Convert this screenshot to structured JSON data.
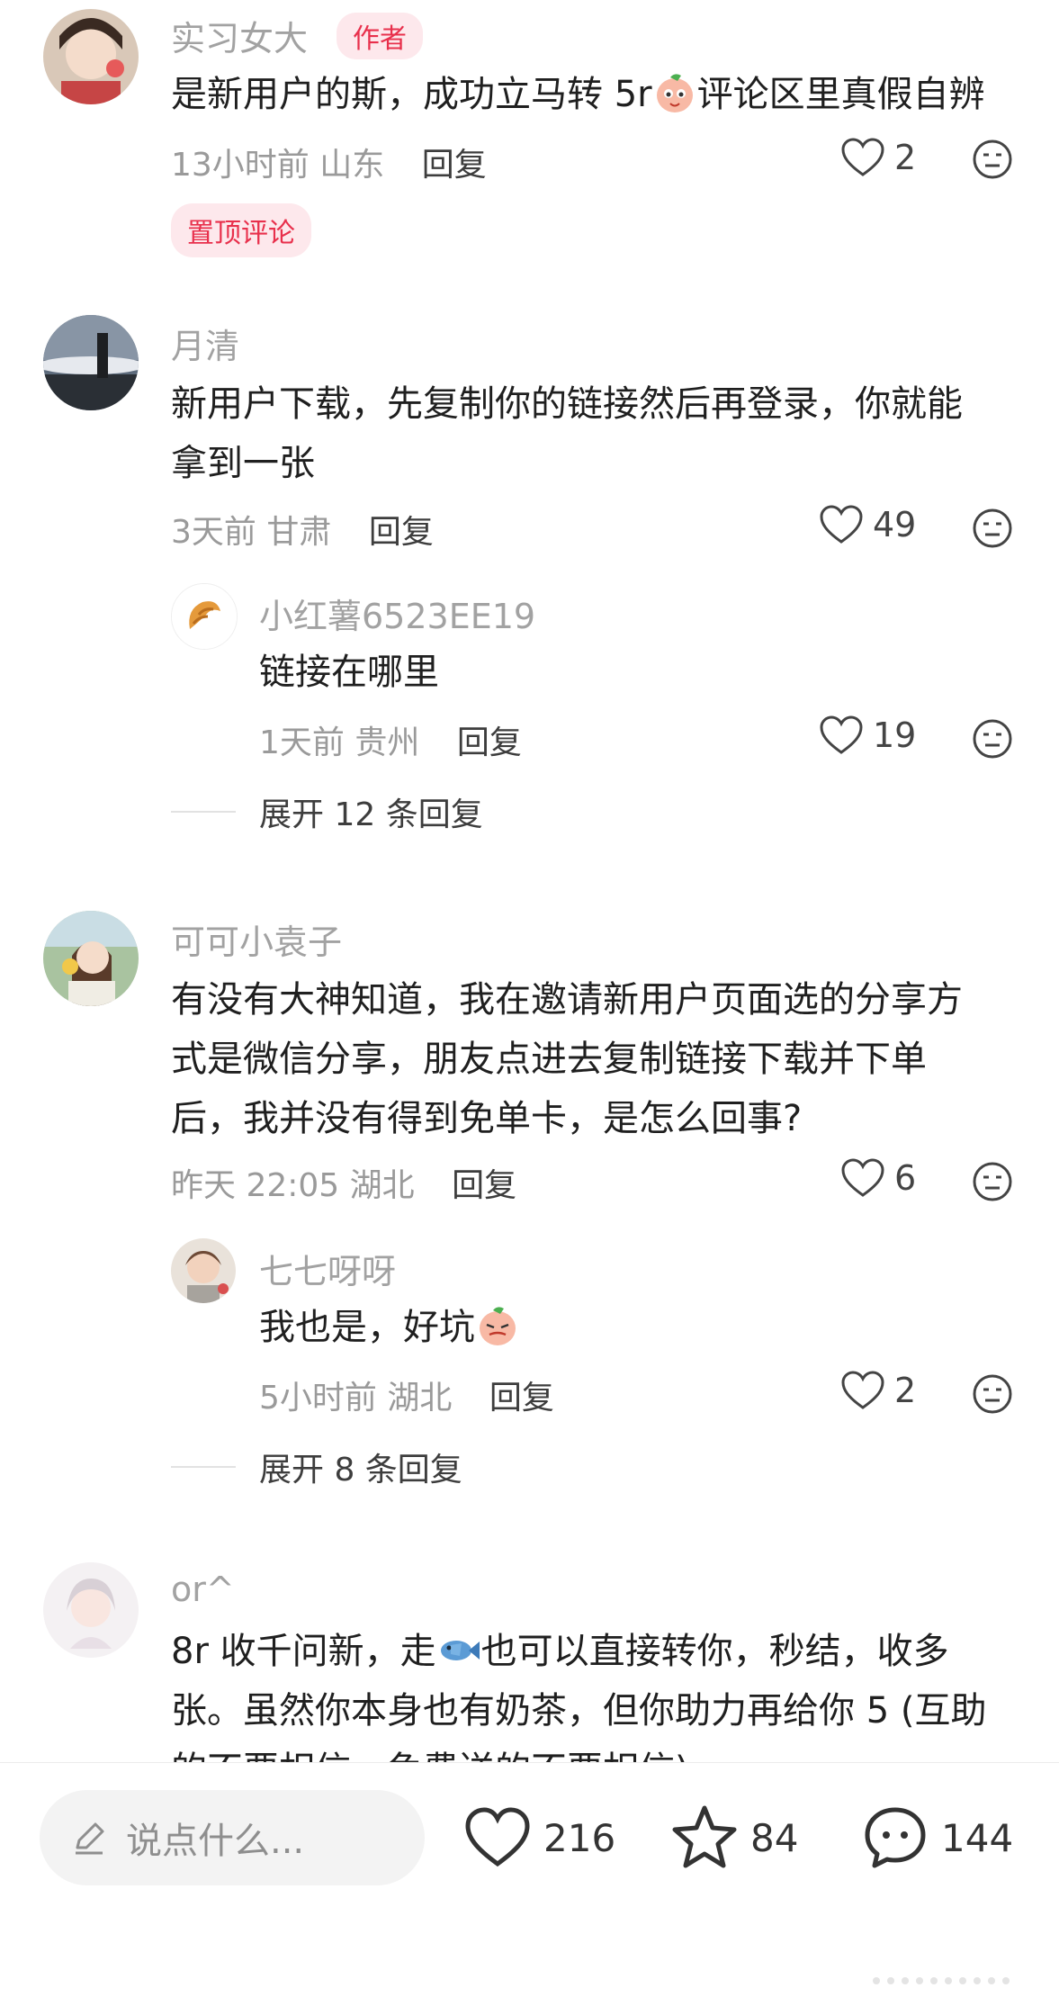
{
  "comments": [
    {
      "name": "实习女大",
      "author_tag": "作者",
      "text_lines": [
        "是新用户的斯，成功立马转 5r",
        "评论区里真假自辨"
      ],
      "time": "13小时前",
      "location": "山东",
      "reply": "回复",
      "likes": "2",
      "pin_tag": "置顶评论"
    },
    {
      "name": "月清",
      "text_lines": [
        "新用户下载，先复制你的链接然后再登录，你就能",
        "拿到一张"
      ],
      "time": "3天前",
      "location": "甘肃",
      "reply": "回复",
      "likes": "49",
      "sub": {
        "name": "小红薯6523EE19",
        "text": "链接在哪里",
        "time": "1天前",
        "location": "贵州",
        "reply": "回复",
        "likes": "19"
      },
      "expand": "展开 12 条回复"
    },
    {
      "name": "可可小袁子",
      "text_lines": [
        "有没有大神知道，我在邀请新用户页面选的分享方",
        "式是微信分享，朋友点进去复制链接下载并下单",
        "后，我并没有得到免单卡，是怎么回事?"
      ],
      "time": "昨天 22:05",
      "location": "湖北",
      "reply": "回复",
      "likes": "6",
      "sub": {
        "name": "七七呀呀",
        "text": "我也是，好坑",
        "time": "5小时前",
        "location": "湖北",
        "reply": "回复",
        "likes": "2"
      },
      "expand": "展开 8 条回复"
    },
    {
      "name": "or^",
      "text_lines": [
        "8r 收千问新，走",
        "也可以直接转你，秒结，收多",
        "张。虽然你本身也有奶茶，但你助力再给你 5 (互助",
        "的不要相信，免费送的不要相信)"
      ]
    }
  ],
  "bottom_bar": {
    "input_placeholder": "说点什么...",
    "likes": "216",
    "stars": "84",
    "comments": "144"
  },
  "colors": {
    "accent": "#e8304c",
    "tag_bg": "#fde8ec",
    "muted": "#9a9a9a"
  }
}
